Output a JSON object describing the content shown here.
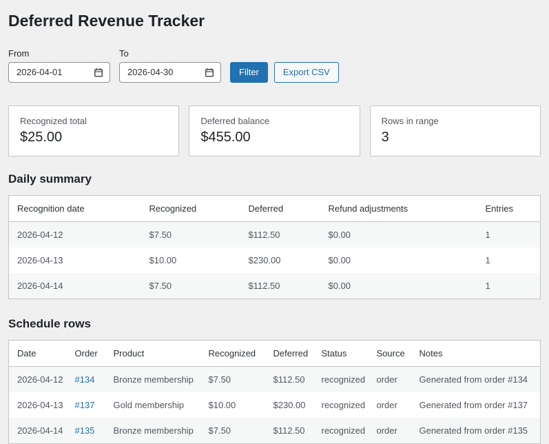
{
  "page": {
    "title": "Deferred Revenue Tracker"
  },
  "filters": {
    "from_label": "From",
    "from_value": "2026-04-01",
    "to_label": "To",
    "to_value": "2026-04-30",
    "filter_button": "Filter",
    "export_button": "Export CSV"
  },
  "cards": [
    {
      "label": "Recognized total",
      "value": "$25.00"
    },
    {
      "label": "Deferred balance",
      "value": "$455.00"
    },
    {
      "label": "Rows in range",
      "value": "3"
    }
  ],
  "daily_summary": {
    "heading": "Daily summary",
    "columns": [
      "Recognition date",
      "Recognized",
      "Deferred",
      "Refund adjustments",
      "Entries"
    ],
    "rows": [
      [
        "2026-04-12",
        "$7.50",
        "$112.50",
        "$0.00",
        "1"
      ],
      [
        "2026-04-13",
        "$10.00",
        "$230.00",
        "$0.00",
        "1"
      ],
      [
        "2026-04-14",
        "$7.50",
        "$112.50",
        "$0.00",
        "1"
      ]
    ]
  },
  "schedule": {
    "heading": "Schedule rows",
    "columns": [
      "Date",
      "Order",
      "Product",
      "Recognized",
      "Deferred",
      "Status",
      "Source",
      "Notes"
    ],
    "rows": [
      {
        "date": "2026-04-12",
        "order": "#134",
        "product": "Bronze membership",
        "recognized": "$7.50",
        "deferred": "$112.50",
        "status": "recognized",
        "source": "order",
        "notes": "Generated from order #134"
      },
      {
        "date": "2026-04-13",
        "order": "#137",
        "product": "Gold membership",
        "recognized": "$10.00",
        "deferred": "$230.00",
        "status": "recognized",
        "source": "order",
        "notes": "Generated from order #137"
      },
      {
        "date": "2026-04-14",
        "order": "#135",
        "product": "Bronze membership",
        "recognized": "$7.50",
        "deferred": "$112.50",
        "status": "recognized",
        "source": "order",
        "notes": "Generated from order #135"
      }
    ]
  },
  "colors": {
    "accent": "#2271b1",
    "background": "#f0f0f1",
    "table_border": "#c3c4c7",
    "row_stripe": "#f6f7f7",
    "heading_text": "#1d2327"
  }
}
